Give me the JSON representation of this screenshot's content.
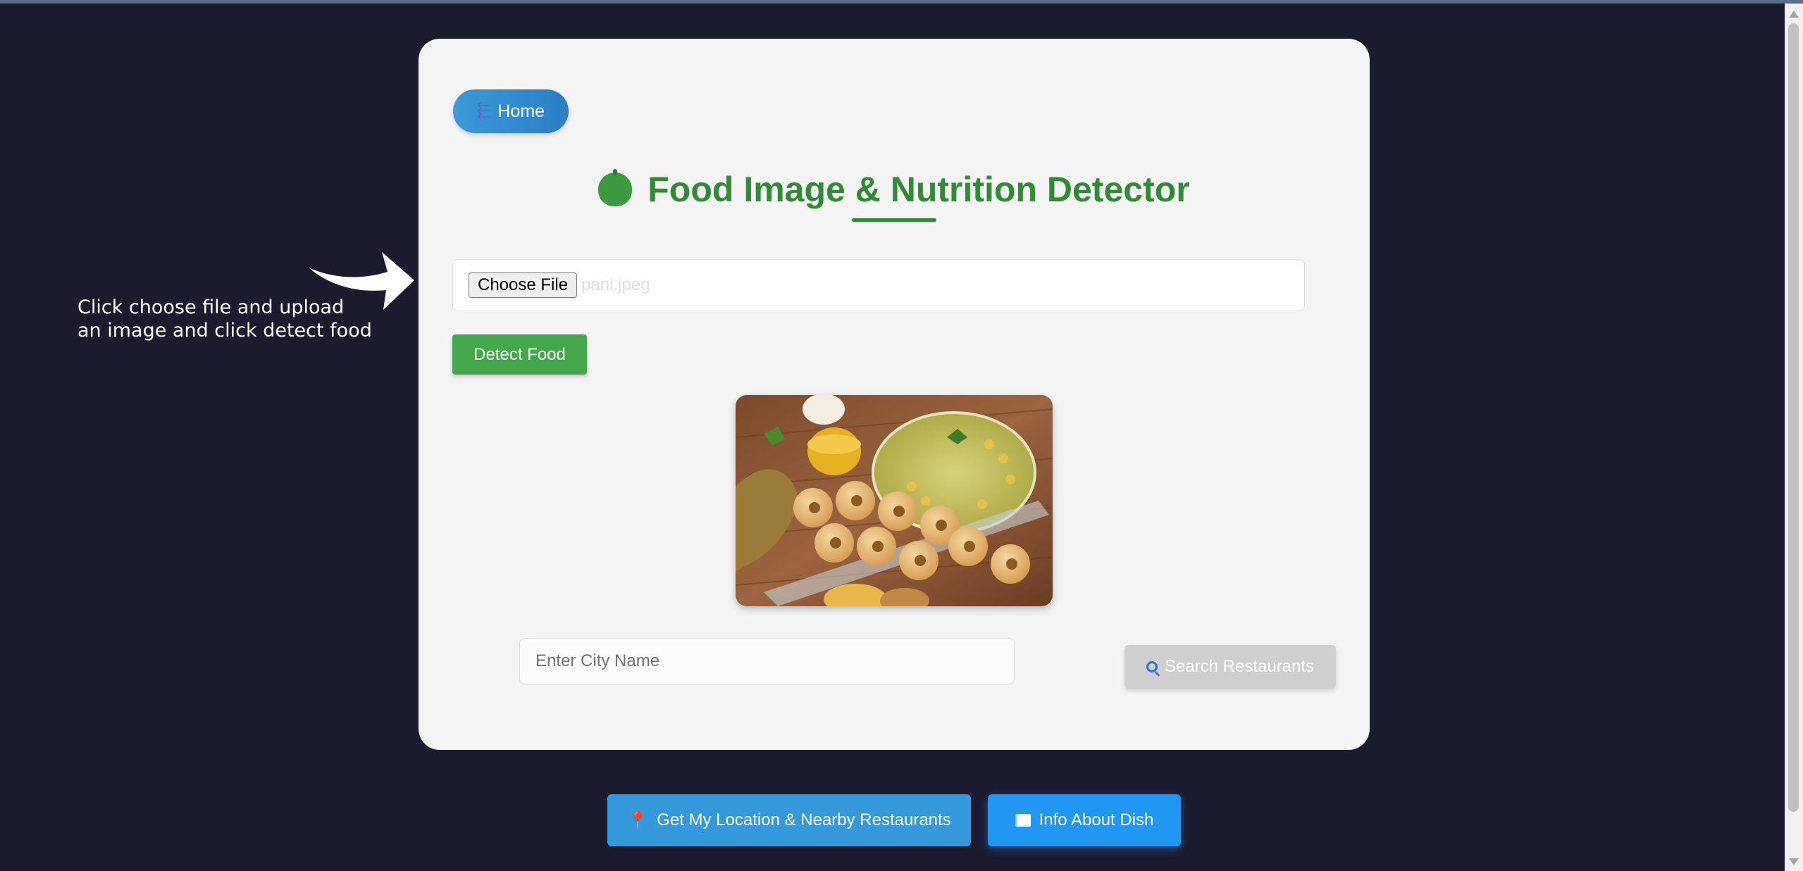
{
  "hint": {
    "text": "Click choose file and upload an image and click detect food"
  },
  "card": {
    "home_label": "Home",
    "home_icon": "back-arrow-icon",
    "title": "Food Image & Nutrition Detector",
    "title_icon": "apple-icon",
    "file": {
      "button_label": "Choose File",
      "file_name": "pani.jpeg"
    },
    "detect_label": "Detect Food",
    "image_alt": "pani puri dish",
    "city": {
      "placeholder": "Enter City Name",
      "value": ""
    },
    "search_label": "Search Restaurants",
    "search_icon": "magnifier-icon"
  },
  "footer": {
    "location_label": "Get My Location & Nearby Restaurants",
    "location_icon": "pin-icon",
    "info_label": "Info About Dish",
    "info_icon": "book-icon"
  },
  "colors": {
    "background": "#1b1b2f",
    "card": "#f4f4f4",
    "title_green": "#2f8c35",
    "detect_green": "#43a848",
    "home_blue": "#2b7fc4",
    "info_blue": "#2196f3"
  }
}
